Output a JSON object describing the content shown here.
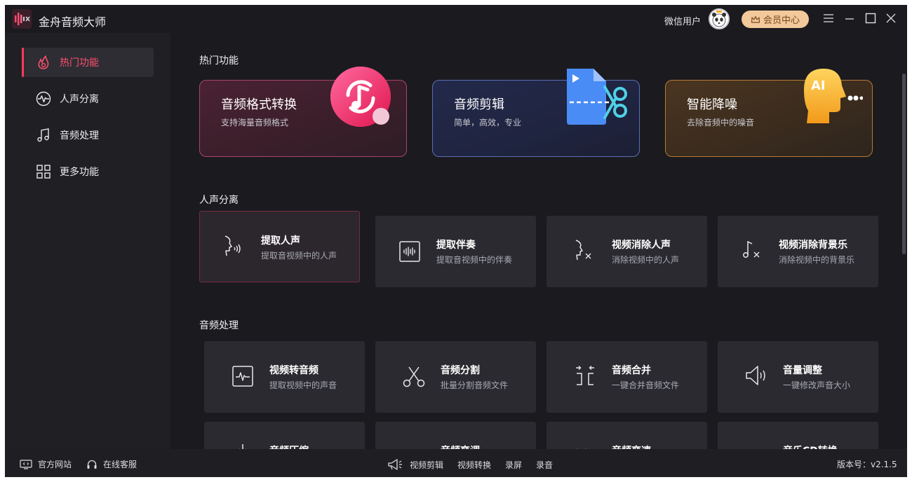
{
  "app": {
    "title": "金舟音频大师"
  },
  "header": {
    "user_name": "微信用户",
    "vip_label": "会员中心"
  },
  "sidebar": {
    "items": [
      {
        "label": "热门功能",
        "icon": "flame-icon",
        "active": true
      },
      {
        "label": "人声分离",
        "icon": "waveform-circle-icon"
      },
      {
        "label": "音频处理",
        "icon": "music-note-icon"
      },
      {
        "label": "更多功能",
        "icon": "grid-icon"
      }
    ]
  },
  "sections": {
    "hot": "热门功能",
    "vocal": "人声分离",
    "audio": "音频处理"
  },
  "hot_cards": [
    {
      "title": "音频格式转换",
      "subtitle": "支持海量音频格式",
      "icon": "music-convert-icon",
      "accent": "#e2457a"
    },
    {
      "title": "音频剪辑",
      "subtitle": "简单，高效，专业",
      "icon": "video-scissors-icon",
      "accent": "#5b7fd6"
    },
    {
      "title": "智能降噪",
      "subtitle": "去除音频中的噪音",
      "icon": "ai-head-icon",
      "accent": "#e79a2b"
    }
  ],
  "vocal_cards": [
    {
      "title": "提取人声",
      "subtitle": "提取音视频中的人声",
      "icon": "voice-head-icon"
    },
    {
      "title": "提取伴奏",
      "subtitle": "提取音视频中的伴奏",
      "icon": "waveform-box-icon"
    },
    {
      "title": "视频消除人声",
      "subtitle": "消除视频中的人声",
      "icon": "voice-remove-icon"
    },
    {
      "title": "视频消除背景乐",
      "subtitle": "消除视频中的背景乐",
      "icon": "music-remove-icon"
    }
  ],
  "audio_cards": [
    {
      "title": "视频转音频",
      "subtitle": "提取视频中的声音",
      "icon": "pulse-box-icon"
    },
    {
      "title": "音频分割",
      "subtitle": "批量分割音频文件",
      "icon": "scissors-icon"
    },
    {
      "title": "音频合并",
      "subtitle": "一键合并音频文件",
      "icon": "merge-icon"
    },
    {
      "title": "音量调整",
      "subtitle": "一键修改声音大小",
      "icon": "speaker-icon"
    }
  ],
  "more_cards": [
    {
      "title": "音频压缩",
      "icon": "compress-icon"
    },
    {
      "title": "音频变调",
      "icon": "equalizer-icon"
    },
    {
      "title": "音频变速",
      "icon": "speed-icon"
    },
    {
      "title": "音乐CD转换",
      "icon": "cd-icon"
    }
  ],
  "footer": {
    "website": "官方网站",
    "support": "在线客服",
    "links": [
      "视频剪辑",
      "视频转换",
      "录屏",
      "录音"
    ],
    "version": "版本号：v2.1.5"
  }
}
